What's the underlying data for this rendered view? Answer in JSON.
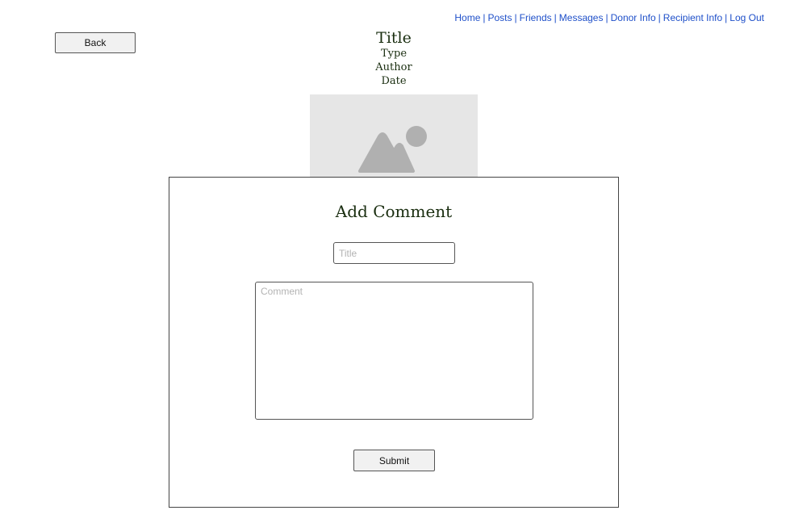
{
  "nav": {
    "items": [
      {
        "label": "Home"
      },
      {
        "label": "Posts"
      },
      {
        "label": "Friends"
      },
      {
        "label": "Messages"
      },
      {
        "label": "Donor Info"
      },
      {
        "label": "Recipient Info"
      },
      {
        "label": "Log Out"
      }
    ],
    "separator": "|",
    "link_color": "#1e4fc9"
  },
  "back_button": {
    "label": "Back"
  },
  "post": {
    "title": "Title",
    "type": "Type",
    "author": "Author",
    "date": "Date",
    "image_icon": "image-placeholder-icon"
  },
  "comment_form": {
    "heading": "Add Comment",
    "title_placeholder": "Title",
    "title_value": "",
    "comment_placeholder": "Comment",
    "comment_value": "",
    "submit_label": "Submit"
  },
  "colors": {
    "heading_text": "#1a2e10",
    "placeholder_bg": "#e6e6e6",
    "placeholder_shape": "#b0b0b0"
  }
}
